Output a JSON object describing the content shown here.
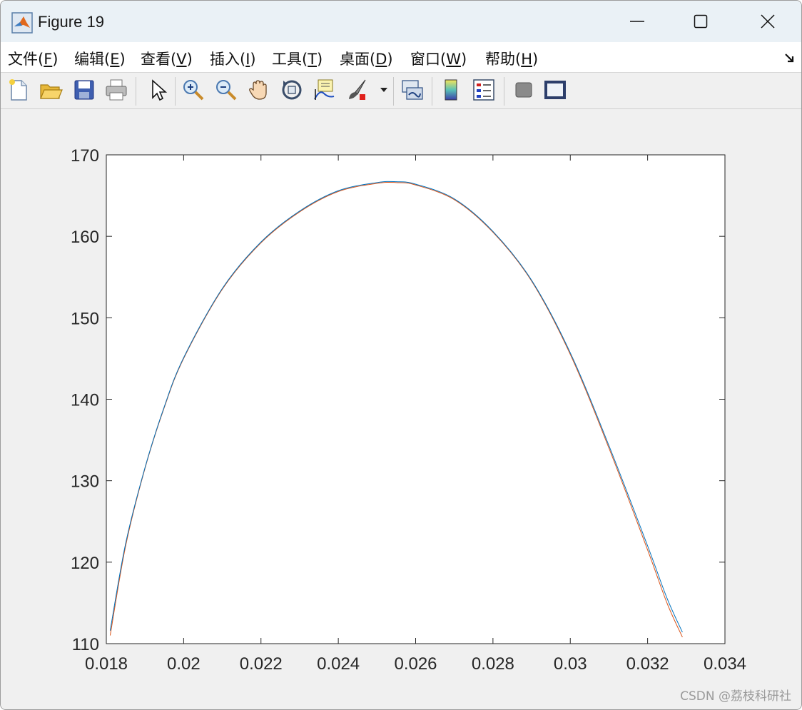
{
  "window": {
    "title": "Figure 19",
    "icon": "matlab-logo-icon",
    "controls": [
      "minimize-icon",
      "maximize-icon",
      "close-icon"
    ]
  },
  "menu": [
    {
      "text": "文件(",
      "acc": "F",
      "end": ")"
    },
    {
      "text": "编辑(",
      "acc": "E",
      "end": ")"
    },
    {
      "text": "查看(",
      "acc": "V",
      "end": ")"
    },
    {
      "text": "插入(",
      "acc": "I",
      "end": ")"
    },
    {
      "text": "工具(",
      "acc": "T",
      "end": ")"
    },
    {
      "text": "桌面(",
      "acc": "D",
      "end": ")"
    },
    {
      "text": "窗口(",
      "acc": "W",
      "end": ")"
    },
    {
      "text": "帮助(",
      "acc": "H",
      "end": ")"
    }
  ],
  "toolbar": [
    "new-figure-icon",
    "open-file-icon",
    "save-icon",
    "print-icon",
    "select-pointer-icon",
    "zoom-in-icon",
    "zoom-out-icon",
    "pan-hand-icon",
    "rotate-3d-icon",
    "data-cursor-icon",
    "brush-icon",
    "brush-dropdown-icon",
    "link-plot-icon",
    "colorbar-icon",
    "legend-icon",
    "hide-plot-tools-icon",
    "show-plot-tools-icon"
  ],
  "chart_data": {
    "type": "line",
    "title": "",
    "xlabel": "",
    "ylabel": "",
    "xlim": [
      0.018,
      0.034
    ],
    "ylim": [
      110,
      170
    ],
    "xticks": [
      "0.018",
      "0.02",
      "0.022",
      "0.024",
      "0.026",
      "0.028",
      "0.03",
      "0.032",
      "0.034"
    ],
    "yticks": [
      "110",
      "120",
      "130",
      "140",
      "150",
      "160",
      "170"
    ],
    "grid": false,
    "legend": "none",
    "series": [
      {
        "color": "#d95319",
        "x": [
          0.0181,
          0.0185,
          0.019,
          0.0195,
          0.02,
          0.021,
          0.022,
          0.023,
          0.024,
          0.025,
          0.0255,
          0.026,
          0.027,
          0.028,
          0.029,
          0.03,
          0.031,
          0.032,
          0.0325,
          0.0329
        ],
        "y": [
          111.0,
          122.0,
          131.5,
          139.0,
          145.0,
          153.5,
          159.2,
          163.0,
          165.5,
          166.5,
          166.6,
          166.3,
          164.5,
          160.5,
          154.5,
          145.5,
          134.0,
          121.5,
          115.0,
          110.8
        ]
      },
      {
        "color": "#0072bd",
        "x": [
          0.0181,
          0.0185,
          0.019,
          0.0195,
          0.02,
          0.021,
          0.022,
          0.023,
          0.024,
          0.025,
          0.0255,
          0.026,
          0.027,
          0.028,
          0.029,
          0.03,
          0.031,
          0.032,
          0.0325,
          0.0329
        ],
        "y": [
          111.6,
          122.3,
          131.6,
          139.1,
          145.1,
          153.6,
          159.3,
          163.1,
          165.6,
          166.6,
          166.7,
          166.4,
          164.6,
          160.6,
          154.6,
          145.7,
          134.3,
          122.0,
          115.6,
          111.4
        ]
      }
    ]
  },
  "watermark": "CSDN @荔枝科研社"
}
